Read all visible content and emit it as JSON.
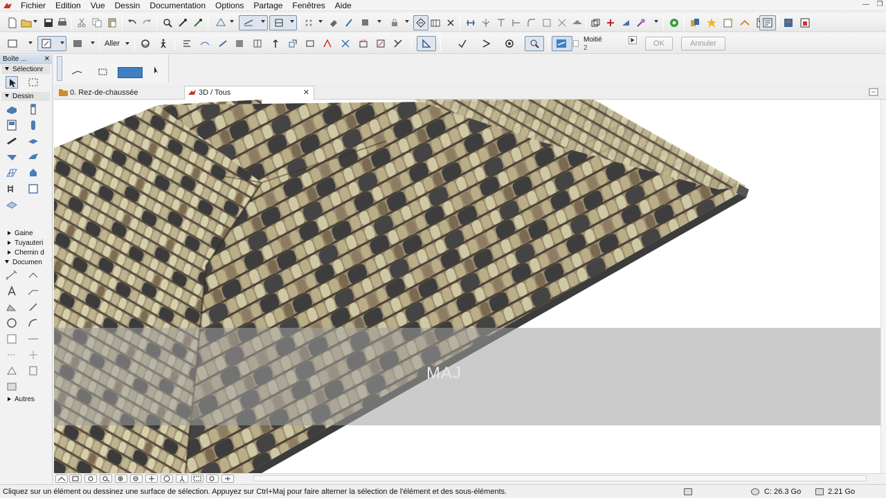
{
  "menubar": {
    "items": [
      "Fichier",
      "Edition",
      "Vue",
      "Dessin",
      "Documentation",
      "Options",
      "Partage",
      "Fenêtres",
      "Aide"
    ]
  },
  "toolbar2": {
    "goto_label": "Aller",
    "half_label": "Moitié",
    "half_value": "2",
    "ok_label": "OK",
    "cancel_label": "Annuler"
  },
  "toolbox": {
    "title": "Boîte ...",
    "close": "✕",
    "selection_group": "Sélectionr",
    "drawing_group": "Dessin",
    "collapsed_groups": [
      "Gaine",
      "Tuyauteri",
      "Chemin d"
    ],
    "documentation_group": "Documen",
    "others_group": "Autres"
  },
  "tabs": [
    {
      "label": "0. Rez-de-chaussée",
      "active": false
    },
    {
      "label": "3D / Tous",
      "active": true,
      "close": "✕"
    }
  ],
  "viewport": {
    "key_overlay": "MAJ"
  },
  "status": {
    "message": "Cliquez sur un élément ou dessinez une surface de sélection. Appuyez sur Ctrl+Maj pour faire alterner la sélection de l'élément et des sous-éléments.",
    "disk_label": "C: 26.3 Go",
    "memory_label": "2.21 Go"
  },
  "colors": {
    "tile_light": "#cfc8a4",
    "tile_mid": "#8d7c62",
    "tile_dark": "#3d3d3d",
    "overlay": "#a0a0a0"
  }
}
